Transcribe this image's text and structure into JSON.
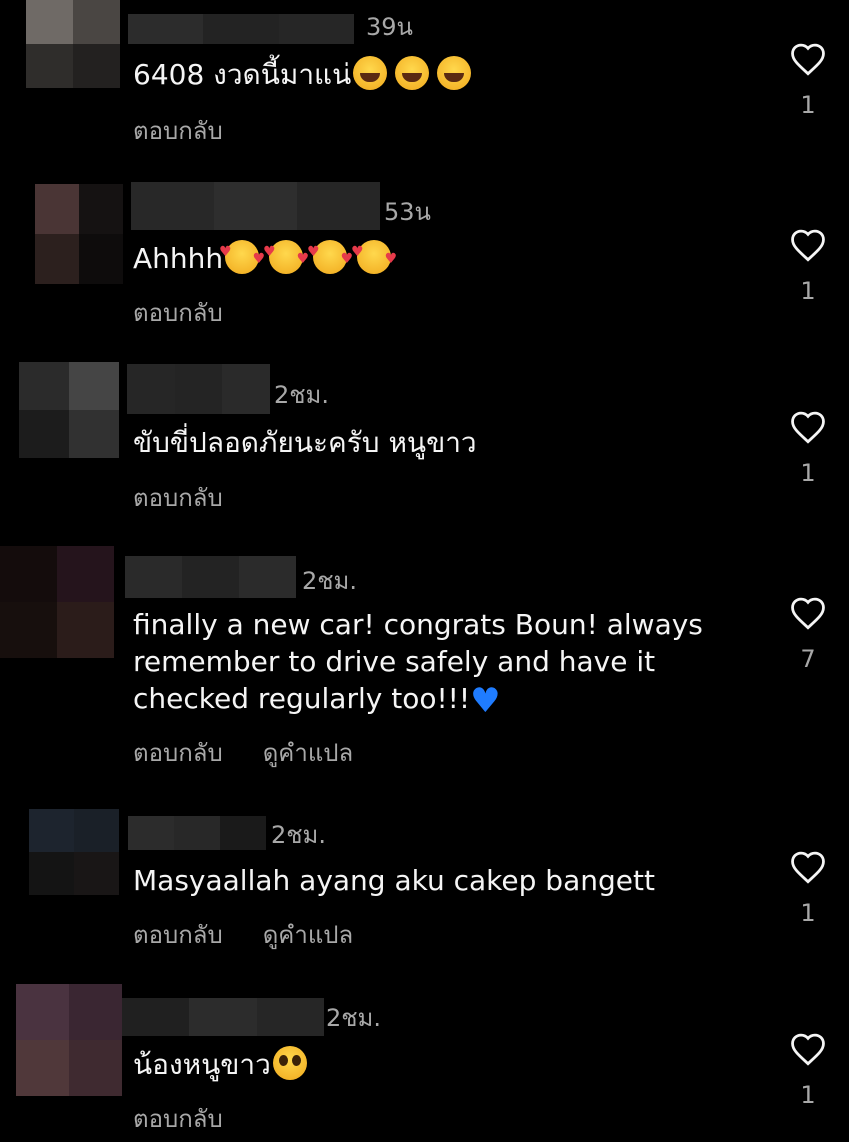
{
  "colors": {
    "background": "#000000",
    "primary_text": "#f5f5f5",
    "secondary_text": "#a8a8a8"
  },
  "actions": {
    "reply": "ตอบกลับ",
    "translate": "ดูคำแปล"
  },
  "comments": [
    {
      "time": "39น",
      "text": "6408 งวดนี้มาแน่",
      "emoji": [
        "laughing-tears-emoji",
        "laughing-tears-emoji",
        "laughing-tears-emoji"
      ],
      "likes": "1",
      "has_translate": false,
      "avatar_colors": [
        "#6f6a66",
        "#4a4643",
        "#2f2d2b",
        "#232120"
      ],
      "name_blur_colors": [
        "#2c2c2c",
        "#232323",
        "#262626"
      ]
    },
    {
      "time": "53น",
      "text": "Ahhhh",
      "emoji": [
        "smiling-face-with-hearts-emoji",
        "smiling-face-with-hearts-emoji",
        "smiling-face-with-hearts-emoji",
        "smiling-face-with-hearts-emoji"
      ],
      "likes": "1",
      "has_translate": false,
      "avatar_colors": [
        "#4a3535",
        "#151212",
        "#2c201e",
        "#0e0c0c"
      ],
      "name_blur_colors": [
        "#282828",
        "#2e2e2e",
        "#262626"
      ]
    },
    {
      "time": "2ชม.",
      "text": "ขับขี่ปลอดภัยนะครับ หนูขาว",
      "emoji": [],
      "likes": "1",
      "has_translate": false,
      "avatar_colors": [
        "#2b2b2b",
        "#454545",
        "#1c1c1c",
        "#313131"
      ],
      "name_blur_colors": [
        "#262626",
        "#242424",
        "#2a2a2a"
      ]
    },
    {
      "time": "2ชม.",
      "text": "finally a new car! congrats Boun! always\nremember to drive safely and have it\nchecked regularly too!!!",
      "emoji": [
        "blue-heart-emoji"
      ],
      "likes": "7",
      "has_translate": true,
      "avatar_colors": [
        "#140c0c",
        "#25141c",
        "#170f0d",
        "#2b1c1a"
      ],
      "name_blur_colors": [
        "#2a2a2a",
        "#232323",
        "#2b2b2b"
      ]
    },
    {
      "time": "2ชม.",
      "text": "Masyaallah ayang aku cakep bangett",
      "emoji": [],
      "likes": "1",
      "has_translate": true,
      "avatar_colors": [
        "#1d242e",
        "#1a2028",
        "#141414",
        "#191616"
      ],
      "name_blur_colors": [
        "#2c2c2c",
        "#282828",
        "#1a1a1a"
      ]
    },
    {
      "time": "2ชม.",
      "text": "น้องหนูขาว",
      "emoji": [
        "pleading-face-emoji"
      ],
      "likes": "1",
      "has_translate": false,
      "avatar_colors": [
        "#4a3340",
        "#3a2632",
        "#50383a",
        "#3f2a30"
      ],
      "name_blur_colors": [
        "#202020",
        "#2c2c2c",
        "#262626"
      ]
    }
  ]
}
